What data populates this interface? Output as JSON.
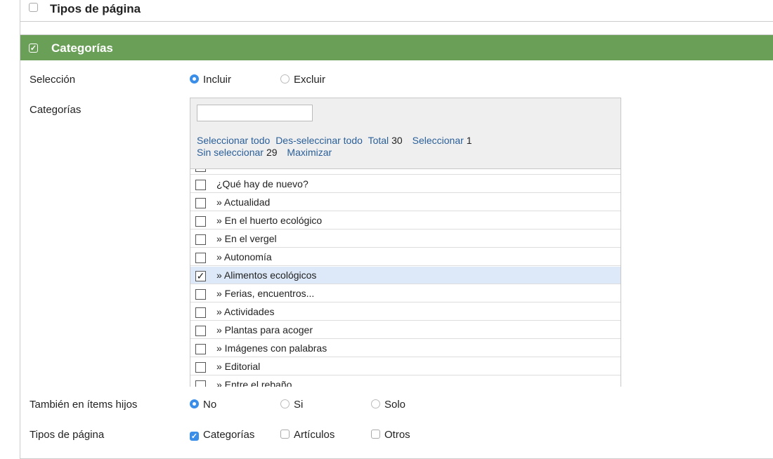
{
  "top_section": {
    "title": "Tipos de página",
    "checked": false
  },
  "categories_section": {
    "title": "Categorías",
    "checked": true,
    "selection": {
      "label": "Selección",
      "options": [
        "Incluir",
        "Excluir"
      ],
      "selected": "Incluir"
    },
    "categories_field": {
      "label": "Categorías",
      "search_value": "",
      "links": {
        "select_all": "Seleccionar todo",
        "deselect_all": "Des-seleccinar todo",
        "total_label": "Total",
        "total_value": "30",
        "selected_label": "Seleccionar",
        "selected_value": "1",
        "unselected_label": "Sin seleccionar",
        "unselected_value": "29",
        "maximize": "Maximizar"
      },
      "items": [
        {
          "label": "",
          "checked": false
        },
        {
          "label": "¿Qué hay de nuevo?",
          "checked": false
        },
        {
          "label": "»  Actualidad",
          "checked": false
        },
        {
          "label": "»  En el huerto ecológico",
          "checked": false
        },
        {
          "label": "»  En el vergel",
          "checked": false
        },
        {
          "label": "»  Autonomía",
          "checked": false
        },
        {
          "label": "»  Alimentos ecológicos",
          "checked": true
        },
        {
          "label": "»  Ferias, encuentros...",
          "checked": false
        },
        {
          "label": "»  Actividades",
          "checked": false
        },
        {
          "label": "»  Plantas para acoger",
          "checked": false
        },
        {
          "label": "»  Imágenes con palabras",
          "checked": false
        },
        {
          "label": "»  Editorial",
          "checked": false
        },
        {
          "label": "»  Entre el rebaño",
          "checked": false
        }
      ]
    },
    "child_items": {
      "label": "También en ítems hijos",
      "options": [
        "No",
        "Si",
        "Solo"
      ],
      "selected": "No"
    },
    "page_types": {
      "label": "Tipos de página",
      "options": [
        {
          "label": "Categorías",
          "checked": true
        },
        {
          "label": "Artículos",
          "checked": false
        },
        {
          "label": "Otros",
          "checked": false
        }
      ]
    }
  },
  "colors": {
    "header_green": "#6a9f57",
    "accent_blue": "#3b8ee8",
    "link_blue": "#2a5f99",
    "selected_row": "#dde9f8"
  }
}
